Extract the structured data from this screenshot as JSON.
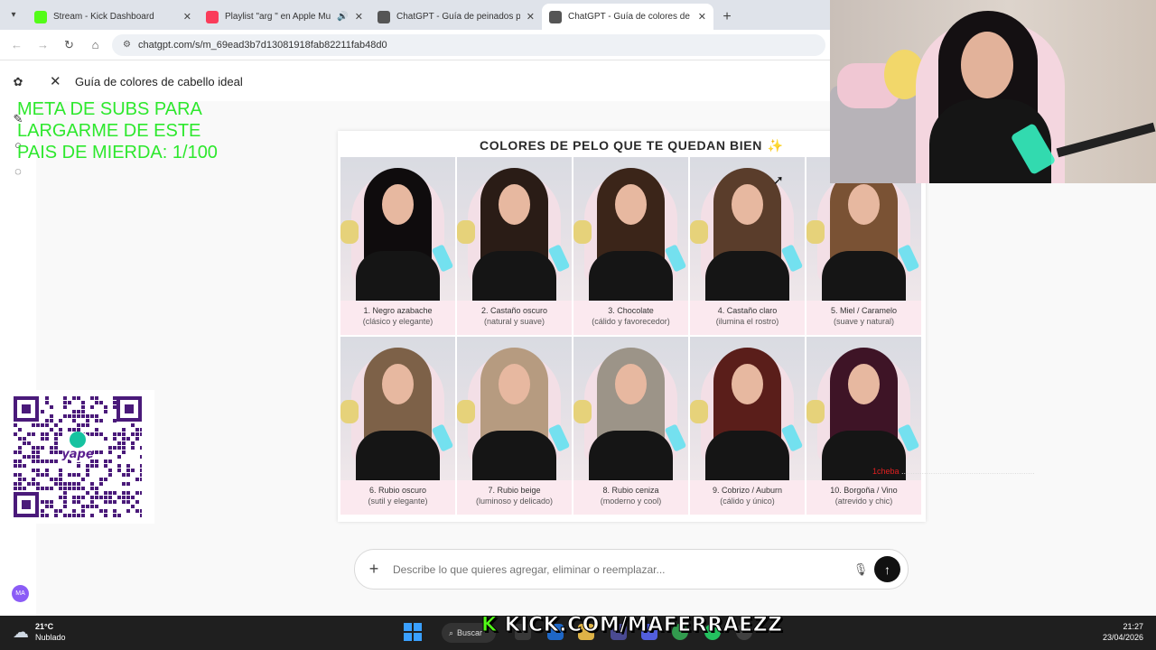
{
  "browser": {
    "tabs": [
      {
        "label": "Stream - Kick Dashboard",
        "favicon": "kick-icon",
        "color": "#53fc18",
        "active": false
      },
      {
        "label": "Playlist \"arg \" en Apple Mu",
        "favicon": "music-icon",
        "color": "#fa3c5a",
        "active": false
      },
      {
        "label": "ChatGPT - Guía de peinados pa",
        "favicon": "chatgpt-icon",
        "color": "#555555",
        "active": false
      },
      {
        "label": "ChatGPT - Guía de colores de c",
        "favicon": "chatgpt-icon",
        "color": "#555555",
        "active": true
      }
    ],
    "url": "chatgpt.com/s/m_69ead3b7d13081918fab82211fab48d0"
  },
  "page": {
    "doc_title": "Guía de colores de cabello ideal"
  },
  "overlay": {
    "goal_text": "META DE SUBS PARA\nLARGARME  DE ESTE\nPAIS  DE MIERDA: 1/100",
    "chat_user": "1cheba",
    "chat_text": "...........................................................",
    "kick_url": "KICK.COM/MAFERRAEZZ"
  },
  "card": {
    "title": "COLORES DE PELO QUE TE QUEDAN BIEN",
    "items": [
      {
        "name": "1. Negro azabache",
        "desc": "(clásico y elegante)",
        "hair": "#0f0c0d"
      },
      {
        "name": "2. Castaño oscuro",
        "desc": "(natural y suave)",
        "hair": "#2a1c16"
      },
      {
        "name": "3. Chocolate",
        "desc": "(cálido y favorecedor)",
        "hair": "#3b2519"
      },
      {
        "name": "4. Castaño claro",
        "desc": "(ilumina el rostro)",
        "hair": "#5a3d2b"
      },
      {
        "name": "5. Miel / Caramelo",
        "desc": "(suave y natural)",
        "hair": "#7a5234"
      },
      {
        "name": "6. Rubio oscuro",
        "desc": "(sutil y elegante)",
        "hair": "#7d6148"
      },
      {
        "name": "7. Rubio beige",
        "desc": "(luminoso y delicado)",
        "hair": "#b69b80"
      },
      {
        "name": "8. Rubio ceniza",
        "desc": "(moderno y cool)",
        "hair": "#9c9488"
      },
      {
        "name": "9. Cobrizo / Auburn",
        "desc": "(cálido y único)",
        "hair": "#5a1e1a"
      },
      {
        "name": "10. Borgoña / Vino",
        "desc": "(atrevido y chic)",
        "hair": "#3e1426"
      }
    ]
  },
  "composer": {
    "placeholder": "Describe lo que quieres agregar, eliminar o reemplazar..."
  },
  "user": {
    "initials": "MA"
  },
  "taskbar": {
    "temperature": "21°C",
    "condition": "Nublado",
    "search_label": "Buscar",
    "time": "21:27",
    "date": "23/04/2026"
  }
}
